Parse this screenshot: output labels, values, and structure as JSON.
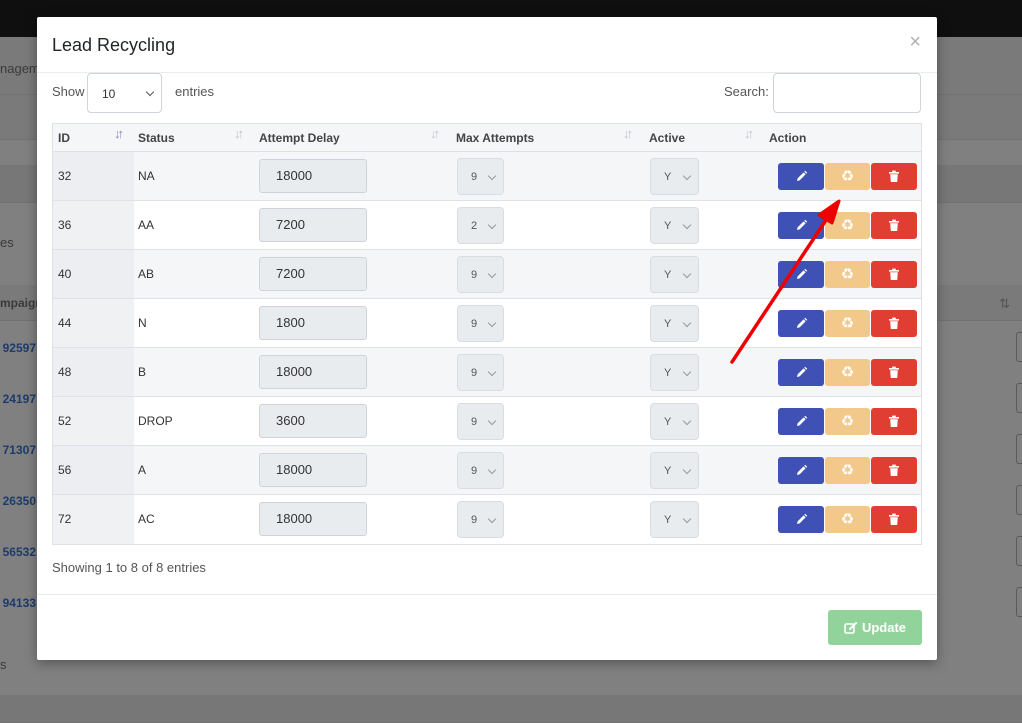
{
  "background": {
    "nav_fragment": "nagem",
    "side_fragment_1": "es",
    "column_fragment": "mpaign",
    "side_fragment_2": "s",
    "campaign_ids": [
      "92597",
      "24197",
      "71307",
      "26350",
      "56532",
      "94133"
    ]
  },
  "modal": {
    "title": "Lead Recycling",
    "close_glyph": "×"
  },
  "controls": {
    "show_label": "Show",
    "entries_label": "entries",
    "page_length": "10",
    "search_label": "Search:",
    "search_value": ""
  },
  "table": {
    "columns": [
      "ID",
      "Status",
      "Attempt Delay",
      "Max Attempts",
      "Active",
      "Action"
    ],
    "rows": [
      {
        "id": "32",
        "status": "NA",
        "delay": "18000",
        "max": "9",
        "active": "Y"
      },
      {
        "id": "36",
        "status": "AA",
        "delay": "7200",
        "max": "2",
        "active": "Y"
      },
      {
        "id": "40",
        "status": "AB",
        "delay": "7200",
        "max": "9",
        "active": "Y"
      },
      {
        "id": "44",
        "status": "N",
        "delay": "1800",
        "max": "9",
        "active": "Y"
      },
      {
        "id": "48",
        "status": "B",
        "delay": "18000",
        "max": "9",
        "active": "Y"
      },
      {
        "id": "52",
        "status": "DROP",
        "delay": "3600",
        "max": "9",
        "active": "Y"
      },
      {
        "id": "56",
        "status": "A",
        "delay": "18000",
        "max": "9",
        "active": "Y"
      },
      {
        "id": "72",
        "status": "AC",
        "delay": "18000",
        "max": "9",
        "active": "Y"
      }
    ]
  },
  "info_text": "Showing 1 to 8 of 8 entries",
  "footer": {
    "update_label": "Update"
  },
  "icons": {
    "edit": "pencil-icon",
    "recycle": "recycle-icon",
    "delete": "trash-icon",
    "update": "edit-square-icon",
    "annotation": "red-arrow-pointer"
  },
  "colors": {
    "edit": "#3f51b5",
    "recycle": "#f3c98b",
    "delete": "#e03e32",
    "update": "#92d39b",
    "arrow": "#ee0000"
  }
}
